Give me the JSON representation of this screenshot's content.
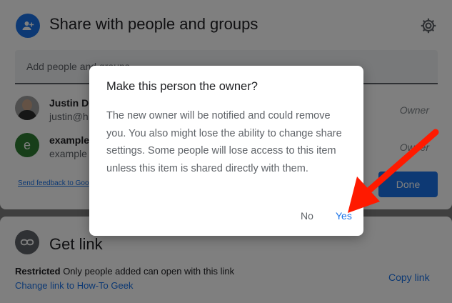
{
  "share": {
    "title": "Share with people and groups",
    "add_placeholder": "Add people and groups",
    "people": [
      {
        "name": "Justin Du",
        "email": "justin@h",
        "role": "Owner",
        "avatar": "photo"
      },
      {
        "name": "example",
        "email": "example",
        "role": "Owner",
        "avatar_letter": "e"
      }
    ],
    "feedback_label": "Send feedback to Goo",
    "done_label": "Done"
  },
  "get_link": {
    "title": "Get link",
    "restricted_label": "Restricted",
    "restricted_desc": " Only people added can open with this link",
    "change_link_label": "Change link to How-To Geek",
    "copy_link_label": "Copy link"
  },
  "dialog": {
    "title": "Make this person the owner?",
    "body": "The new owner will be notified and could remove you. You also might lose the ability to change share settings. Some people will lose access to this item unless this item is shared directly with them.",
    "no_label": "No",
    "yes_label": "Yes"
  },
  "colors": {
    "accent": "#1a73e8",
    "arrow": "#ff1a00",
    "avatar_e": "#2e7d32"
  },
  "icons": [
    "person-add-icon",
    "gear-icon",
    "link-icon"
  ]
}
